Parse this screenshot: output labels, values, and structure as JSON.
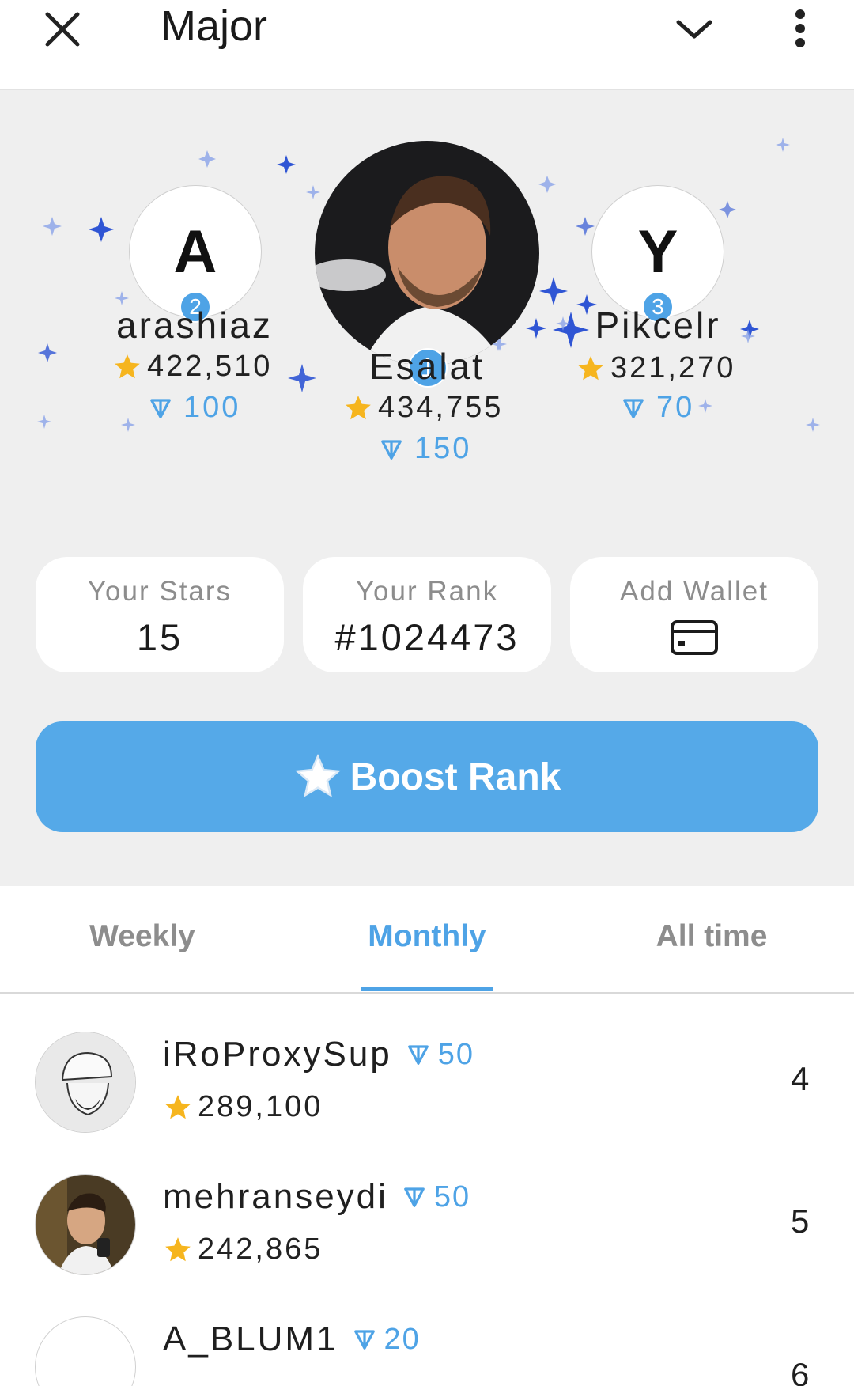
{
  "app": {
    "title": "Major"
  },
  "podium": {
    "first": {
      "rank": "1",
      "name": "Esalat",
      "stars": "434,755",
      "ton": "150"
    },
    "second": {
      "rank": "2",
      "initial": "A",
      "name": "arashiaz",
      "stars": "422,510",
      "ton": "100"
    },
    "third": {
      "rank": "3",
      "initial": "Y",
      "name": "Pikcelr",
      "stars": "321,270",
      "ton": "70"
    }
  },
  "stats": {
    "stars_label": "Your Stars",
    "stars_value": "15",
    "rank_label": "Your Rank",
    "rank_value": "#1024473",
    "wallet_label": "Add Wallet"
  },
  "boost": {
    "label": "Boost Rank"
  },
  "tabs": [
    {
      "label": "Weekly",
      "active": false
    },
    {
      "label": "Monthly",
      "active": true
    },
    {
      "label": "All time",
      "active": false
    }
  ],
  "leaderboard": [
    {
      "name": "iRoProxySup",
      "ton": "50",
      "stars": "289,100",
      "rank": "4"
    },
    {
      "name": "mehranseydi",
      "ton": "50",
      "stars": "242,865",
      "rank": "5"
    },
    {
      "name": "A_BLUM1",
      "ton": "20",
      "rank": "6"
    }
  ],
  "colors": {
    "accent": "#4ea3e6",
    "button": "#55a9e8",
    "podium_bg": "#efefef",
    "star": "#f6b51e"
  },
  "icons": [
    "close-icon",
    "chevron-down-icon",
    "more-vert-icon",
    "star-icon",
    "ton-icon",
    "wallet-card-icon"
  ]
}
